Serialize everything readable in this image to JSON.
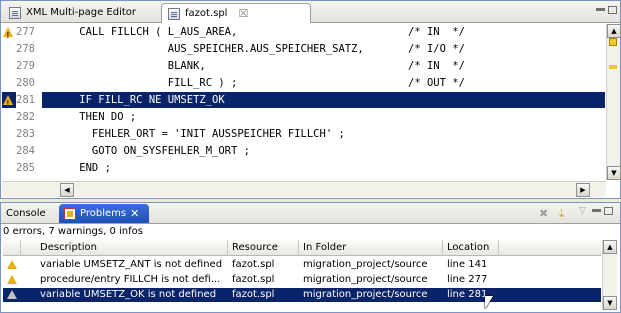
{
  "editor": {
    "tabs": [
      {
        "label": "XML Multi-page Editor",
        "active": false
      },
      {
        "label": "fazot.spl",
        "active": true,
        "close": "☒"
      }
    ],
    "lines": [
      {
        "num": "277",
        "code": "    CALL FILLCH ( L_AUS_AREA,                           /* IN  */",
        "warning": true,
        "selected": false
      },
      {
        "num": "278",
        "code": "                  AUS_SPEICHER.AUS_SPEICHER_SATZ,       /* I/O */",
        "warning": false,
        "selected": false
      },
      {
        "num": "279",
        "code": "                  BLANK,                                /* IN  */",
        "warning": false,
        "selected": false
      },
      {
        "num": "280",
        "code": "                  FILL_RC ) ;                           /* OUT */",
        "warning": false,
        "selected": false
      },
      {
        "num": "281",
        "code": "    IF FILL_RC NE UMSETZ_OK",
        "warning": true,
        "selected": true
      },
      {
        "num": "282",
        "code": "    THEN DO ;",
        "warning": false,
        "selected": false
      },
      {
        "num": "283",
        "code": "      FEHLER_ORT = 'INIT AUSSPEICHER FILLCH' ;",
        "warning": false,
        "selected": false
      },
      {
        "num": "284",
        "code": "      GOTO ON_SYSFEHLER_M_ORT ;",
        "warning": false,
        "selected": false
      },
      {
        "num": "285",
        "code": "    END ;",
        "warning": false,
        "selected": false
      }
    ]
  },
  "problems": {
    "tabs": [
      {
        "label": "Console",
        "active": false
      },
      {
        "label": "Problems",
        "active": true,
        "close": "✕"
      }
    ],
    "summary": "0 errors, 7 warnings, 0 infos",
    "columns": [
      "Description",
      "Resource",
      "In Folder",
      "Location"
    ],
    "rows": [
      {
        "description": "variable UMSETZ_ANT is not defined",
        "resource": "fazot.spl",
        "folder": "migration_project/source",
        "location": "line 141",
        "selected": false
      },
      {
        "description": "procedure/entry FILLCH is not defi...",
        "resource": "fazot.spl",
        "folder": "migration_project/source",
        "location": "line 277",
        "selected": false
      },
      {
        "description": "variable UMSETZ_OK is not defined",
        "resource": "fazot.spl",
        "folder": "migration_project/source",
        "location": "line 281",
        "selected": true
      }
    ]
  },
  "colors": {
    "selection": "#0a246a",
    "warning": "#e8b010",
    "active_tab": "#2a5fc8"
  },
  "icons": [
    "file-icon",
    "warning-icon",
    "problems-icon",
    "minimize-icon",
    "maximize-icon",
    "close-icon"
  ]
}
